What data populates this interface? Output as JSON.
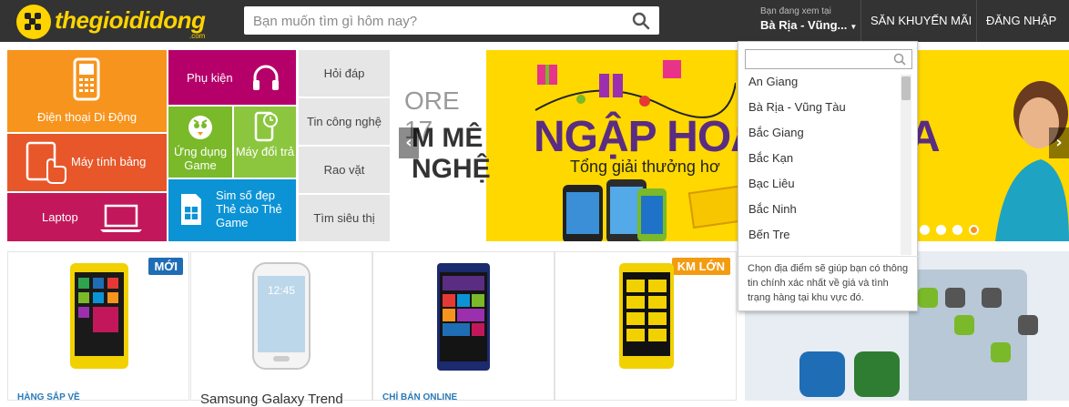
{
  "header": {
    "logo_text": "thegioididong",
    "logo_domain": ".com",
    "search_placeholder": "Bạn muốn tìm gì hôm nay?",
    "location_caption": "Bạn đang xem tại",
    "location_value": "Bà Rịa - Vũng...",
    "promo_link": "SĂN KHUYẾN MÃI",
    "login_link": "ĐĂNG NHẬP"
  },
  "categories": {
    "phone": "Điện thoại Di Động",
    "accessories": "Phụ kiện",
    "apps": "Ứng dụng Game",
    "trade_in": "Máy đổi trả",
    "tablet": "Máy tính bảng",
    "laptop": "Laptop",
    "sim": "Sim số đẹp Thẻ cào Thẻ Game"
  },
  "quick_links": [
    "Hỏi đáp",
    "Tin công nghệ",
    "Rao vặt",
    "Tìm siêu thị"
  ],
  "banner": {
    "headline": "NGẬP HOA",
    "headline_tail": "A",
    "subline": "Tổng giải thưởng hơ",
    "left_peek_line1": "ORE 17",
    "left_peek_line2": "M MÊ",
    "left_peek_line3": "NGHỆ",
    "dots_total": 4,
    "active_dot": 3,
    "accent_color": "#ffd800",
    "headline_color": "#5a2d82"
  },
  "products": [
    {
      "badge": "MỚI",
      "badge_color": "#1f6db5",
      "tag": "HÀNG SẮP VỀ",
      "name": ""
    },
    {
      "badge": "",
      "badge_color": "",
      "tag": "",
      "name": "Samsung Galaxy Trend"
    },
    {
      "badge": "",
      "badge_color": "",
      "tag": "CHỈ BÁN ONLINE",
      "name": ""
    },
    {
      "badge": "KM LỚN",
      "badge_color": "#f39c12",
      "tag": "",
      "name": ""
    }
  ],
  "location_dropdown": {
    "search_value": "",
    "items": [
      "An Giang",
      "Bà Rịa - Vũng Tàu",
      "Bắc Giang",
      "Bắc Kạn",
      "Bạc Liêu",
      "Bắc Ninh",
      "Bến Tre"
    ],
    "hint": "Chọn địa điểm sẽ giúp bạn có thông tin chính xác nhất về giá và tình trạng hàng tại khu vực đó."
  },
  "colors": {
    "header_bg": "#333333",
    "logo_yellow": "#ffd400",
    "orange": "#f7941d",
    "magenta": "#b5006a",
    "green": "#7ab929",
    "red_orange": "#e8572a",
    "crimson": "#c2185b",
    "blue": "#0b93d5",
    "gray_tile": "#e6e6e6"
  }
}
